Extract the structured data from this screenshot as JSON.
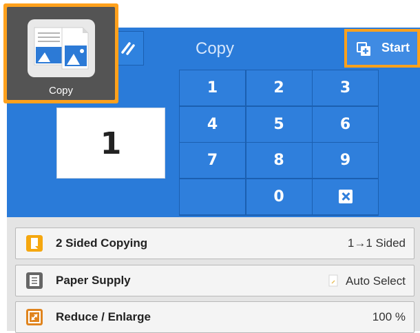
{
  "home": {
    "label": "Copy",
    "icon": "copy-app-icon"
  },
  "header": {
    "title": "Copy",
    "reset_icon": "reset-icon"
  },
  "start": {
    "label": "Start",
    "icon": "start-icon"
  },
  "quantity": {
    "value": "1"
  },
  "keypad": {
    "keys": [
      "1",
      "2",
      "3",
      "4",
      "5",
      "6",
      "7",
      "8",
      "9",
      "",
      "0",
      "clear"
    ]
  },
  "features": [
    {
      "label": "2 Sided Copying",
      "value": "1→1 Sided",
      "icon": "two-sided-copy-icon",
      "color": "#f5a70f"
    },
    {
      "label": "Paper Supply",
      "value": "Auto Select",
      "icon": "paper-supply-icon",
      "color": "#666666"
    },
    {
      "label": "Reduce / Enlarge",
      "value": "100 %",
      "icon": "reduce-enlarge-icon",
      "color": "#e0841e"
    }
  ],
  "colors": {
    "accent": "#ffa11c",
    "panel": "#2a7bd9",
    "key": "#2f7fdc"
  }
}
